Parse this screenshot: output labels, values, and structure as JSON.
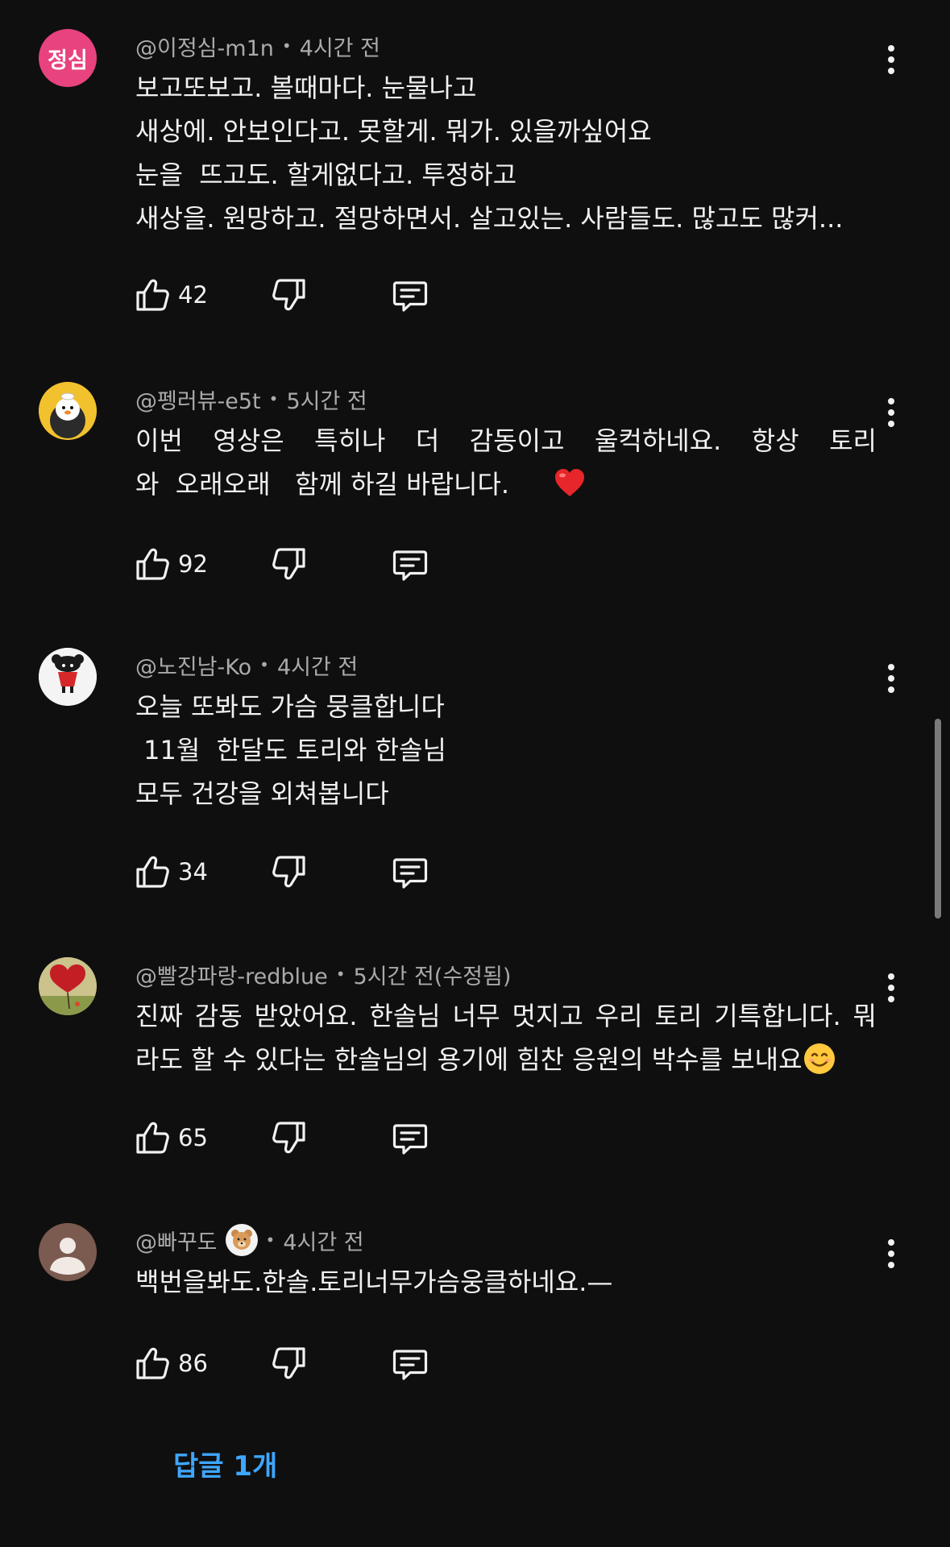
{
  "comments": [
    {
      "author": "@이정심-m1n",
      "time": "4시간 전",
      "avatar_text": "정심",
      "avatar_color": "#e8437f",
      "lines": [
        "보고또보고. 볼때마다. 눈물나고",
        "새상에. 안보인다고. 못할게. 뭐가. 있을까싶어요",
        "눈을  뜨고도. 할게없다고. 투정하고",
        "새상을. 원망하고. 절망하면서. 살고있는. 사람들도. 많고도 많커..."
      ],
      "likes": "42"
    },
    {
      "author": "@펭러뷰-e5t",
      "time": "5시간 전",
      "lines": [
        "이번 영상은 특히나 더 감동이고 울컥하네요. 항상 토리",
        "와  오래오래   함께 하길 바랍니다."
      ],
      "likes": "92"
    },
    {
      "author": "@노진남-Ko",
      "time": "4시간 전",
      "lines": [
        "오늘 또봐도 가슴 뭉클합니다",
        " 11월  한달도 토리와 한솔님",
        "모두 건강을 외쳐봅니다"
      ],
      "likes": "34"
    },
    {
      "author": "@빨강파랑-redblue",
      "time": "5시간 전(수정됨)",
      "lines": [
        "진짜 감동 받았어요. 한솔님 너무 멋지고 우리 토리 기특합니다. 뭐",
        "라도 할 수 있다는 한솔님의 용기에 힘찬 응원의 박수를 보내요"
      ],
      "likes": "65"
    },
    {
      "author": "@빠꾸도",
      "time": "4시간 전",
      "lines": [
        "백번을봐도.한솔.토리너무가슴웅클하네요.—"
      ],
      "likes": "86"
    }
  ],
  "replies_link": "답글 1개",
  "icons": {
    "like": "thumbs-up-icon",
    "dislike": "thumbs-down-icon",
    "reply": "comment-icon",
    "more": "more-vertical-icon",
    "heart": "red-heart-emoji",
    "smile": "smiling-face-emoji",
    "badge": "bear-badge-icon"
  },
  "colors": {
    "background": "#0f0f0f",
    "text": "#f1f1f1",
    "secondary_text": "#aaaaaa",
    "link": "#3ea6ff"
  }
}
